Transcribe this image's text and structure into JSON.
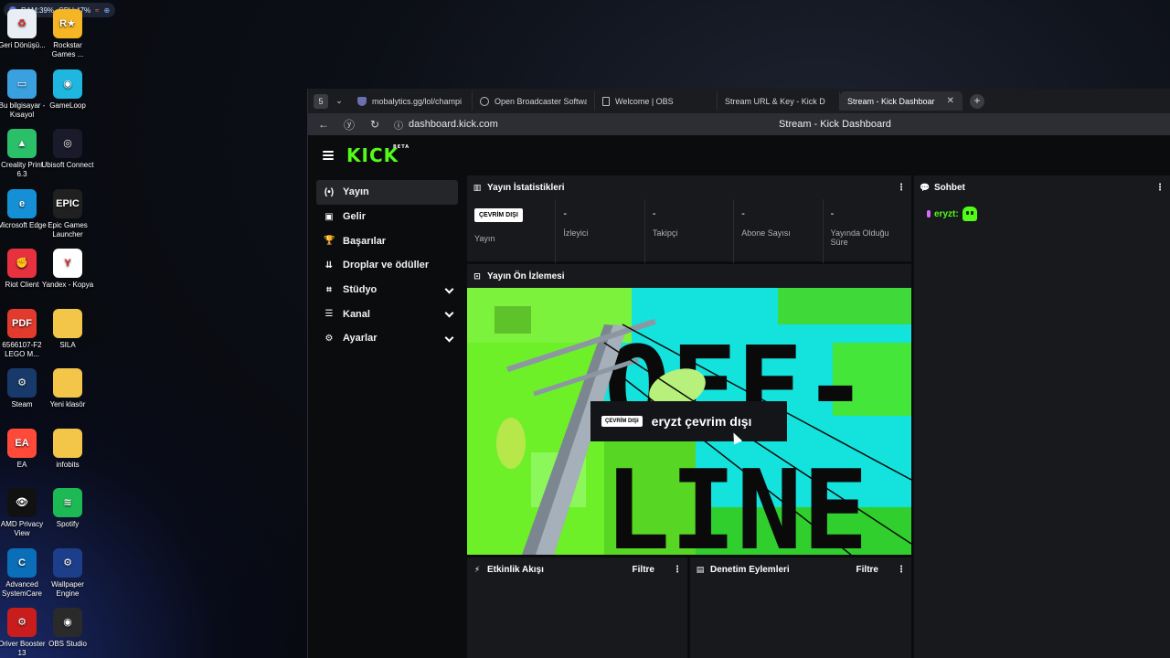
{
  "system": {
    "ram": "RAM:39%",
    "cpu": "CPU:47%"
  },
  "desktop": {
    "icons": [
      {
        "label": "Geri Dönüşü...",
        "name": "recycle-bin-icon",
        "color": "#e9eef5",
        "glyph": "♻"
      },
      {
        "label": "Rockstar Games ...",
        "name": "rockstar-games-icon",
        "color": "#f6b524",
        "glyph": "R★"
      },
      {
        "label": "Bu bilgisayar - Kısayol",
        "name": "this-pc-icon",
        "color": "#3aa0e0",
        "glyph": "▭"
      },
      {
        "label": "GameLoop",
        "name": "gameloop-icon",
        "color": "#1fb7e0",
        "glyph": "◉"
      },
      {
        "label": "Creality Print 6.3",
        "name": "creality-print-icon",
        "color": "#2bbf6a",
        "glyph": "▲"
      },
      {
        "label": "Ubisoft Connect",
        "name": "ubisoft-connect-icon",
        "color": "#1a1a2a",
        "glyph": "◎"
      },
      {
        "label": "Microsoft Edge",
        "name": "microsoft-edge-icon",
        "color": "#1590d6",
        "glyph": "e"
      },
      {
        "label": "Epic Games Launcher",
        "name": "epic-games-icon",
        "color": "#202020",
        "glyph": "EPIC"
      },
      {
        "label": "Riot Client",
        "name": "riot-client-icon",
        "color": "#e8313f",
        "glyph": "✊"
      },
      {
        "label": "Yandex - Kopya",
        "name": "yandex-icon",
        "color": "#ffffff",
        "glyph": "Y"
      },
      {
        "label": "6566107-F2 LEGO M...",
        "name": "pdf-file-icon",
        "color": "#e23b2e",
        "glyph": "PDF"
      },
      {
        "label": "SILA",
        "name": "folder-icon",
        "color": "#f3c64a",
        "glyph": ""
      },
      {
        "label": "Steam",
        "name": "steam-icon",
        "color": "#173a6b",
        "glyph": "⚙"
      },
      {
        "label": "Yeni klasör",
        "name": "folder-icon",
        "color": "#f3c64a",
        "glyph": ""
      },
      {
        "label": "EA",
        "name": "ea-icon",
        "color": "#ff4a3a",
        "glyph": "EA"
      },
      {
        "label": "infobits",
        "name": "folder-icon",
        "color": "#f3c64a",
        "glyph": ""
      },
      {
        "label": "AMD Privacy View",
        "name": "amd-privacy-view-icon",
        "color": "#111111",
        "glyph": "👁"
      },
      {
        "label": "Spotify",
        "name": "spotify-icon",
        "color": "#1db954",
        "glyph": "≋"
      },
      {
        "label": "Advanced SystemCare",
        "name": "advanced-systemcare-icon",
        "color": "#0a6fb8",
        "glyph": "C"
      },
      {
        "label": "Wallpaper Engine",
        "name": "wallpaper-engine-icon",
        "color": "#1d3e8a",
        "glyph": "⚙"
      },
      {
        "label": "Driver Booster 13",
        "name": "driver-booster-icon",
        "color": "#c91d1d",
        "glyph": "⚙"
      },
      {
        "label": "OBS Studio",
        "name": "obs-studio-icon",
        "color": "#2a2a2a",
        "glyph": "◉"
      }
    ]
  },
  "browser": {
    "workspace_badge": "5",
    "tabs": [
      {
        "label": "mobalytics.gg/lol/champi",
        "fav": "shield",
        "active": false
      },
      {
        "label": "Open Broadcaster Softwa",
        "fav": "circle",
        "active": false
      },
      {
        "label": "Welcome | OBS",
        "fav": "doc",
        "active": false
      },
      {
        "label": "Stream URL & Key - Kick D",
        "fav": "kick",
        "active": false
      },
      {
        "label": "Stream - Kick Dashboar",
        "fav": "kick",
        "active": true
      }
    ],
    "url": "dashboard.kick.com",
    "page_title": "Stream - Kick Dashboard"
  },
  "kick": {
    "logo": "KICK",
    "logo_tag": "BETA",
    "nav": [
      {
        "label": "Yayın",
        "icon": "(•)",
        "icon_name": "broadcast-icon",
        "active": true,
        "expand": false
      },
      {
        "label": "Gelir",
        "icon": "▣",
        "icon_name": "revenue-icon",
        "active": false,
        "expand": false
      },
      {
        "label": "Başarılar",
        "icon": "🏆",
        "icon_name": "trophy-icon",
        "active": false,
        "expand": false
      },
      {
        "label": "Droplar ve ödüller",
        "icon": "⇊",
        "icon_name": "drops-icon",
        "active": false,
        "expand": false
      },
      {
        "label": "Stüdyo",
        "icon": "⌗",
        "icon_name": "studio-icon",
        "active": false,
        "expand": true
      },
      {
        "label": "Kanal",
        "icon": "☰",
        "icon_name": "channel-icon",
        "active": false,
        "expand": true
      },
      {
        "label": "Ayarlar",
        "icon": "⚙",
        "icon_name": "settings-icon",
        "active": false,
        "expand": true
      }
    ],
    "stats": {
      "title": "Yayın İstatistikleri",
      "status_badge": "ÇEVRİM DIŞI",
      "cells": [
        {
          "label": "Yayın",
          "value": ""
        },
        {
          "label": "İzleyici",
          "value": "-"
        },
        {
          "label": "Takipçi",
          "value": "-"
        },
        {
          "label": "Abone Sayısı",
          "value": "-"
        },
        {
          "label": "Yayında Olduğu Süre",
          "value": "-"
        }
      ]
    },
    "preview": {
      "title": "Yayın Ön İzlemesi",
      "badge": "ÇEVRİM DIŞI",
      "message": "eryzt çevrim dışı",
      "art_text_1": "OFF-",
      "art_text_2": "LINE"
    },
    "chat": {
      "title": "Sohbet",
      "messages": [
        {
          "user": "eryzt:"
        }
      ]
    },
    "activity": {
      "title": "Etkinlik Akışı",
      "filter": "Filtre"
    },
    "moderation": {
      "title": "Denetim Eylemleri",
      "filter": "Filtre"
    },
    "colors": {
      "brand": "#53fc18",
      "panel": "#18191c",
      "bg": "#0b0c0d"
    }
  }
}
